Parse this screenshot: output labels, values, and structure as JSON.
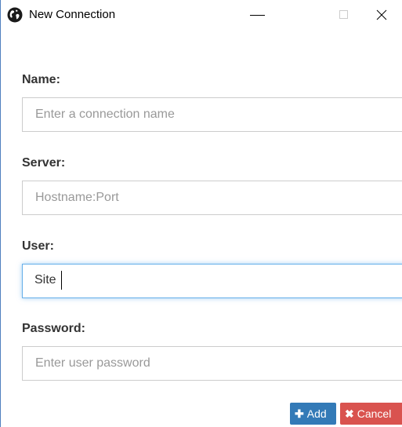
{
  "window": {
    "title": "New Connection",
    "icon": "globe-icon",
    "controls": {
      "minimize": "minimize-icon",
      "maximize": "maximize-icon",
      "close": "close-icon"
    }
  },
  "form": {
    "name": {
      "label": "Name:",
      "placeholder": "Enter a connection name",
      "value": ""
    },
    "server": {
      "label": "Server:",
      "placeholder": "Hostname:Port",
      "value": ""
    },
    "user": {
      "label": "User:",
      "placeholder": "",
      "value": "Site"
    },
    "password": {
      "label": "Password:",
      "placeholder": "Enter user password",
      "value": ""
    }
  },
  "buttons": {
    "add": {
      "label": "Add",
      "icon": "plus-icon",
      "color": "#337ab7"
    },
    "cancel": {
      "label": "Cancel",
      "icon": "x-icon",
      "color": "#d9534f"
    }
  },
  "colors": {
    "focus_border": "#66afe9",
    "input_border": "#cccccc",
    "window_border": "#4f7fbf"
  }
}
